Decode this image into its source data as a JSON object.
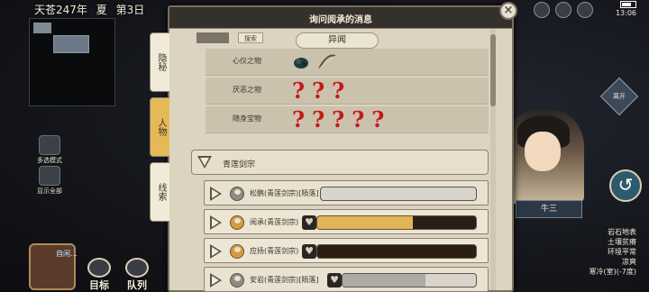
{
  "status_bar": {
    "date": "天苍247年",
    "season": "夏",
    "day": "第3日",
    "clock": "13:06"
  },
  "left_panel": {
    "buttons": [
      {
        "label": "多选模式"
      },
      {
        "label": "显示全部"
      }
    ],
    "npc_label": "自闲…",
    "bottom_buttons": [
      {
        "label": "目标"
      },
      {
        "label": "队列"
      }
    ]
  },
  "dialog": {
    "title": "询问阅承的消息",
    "close": "×",
    "tabs": [
      {
        "label": "隐秘",
        "active": false
      },
      {
        "label": "人物",
        "active": true
      },
      {
        "label": "线索",
        "active": false
      }
    ],
    "search_tag": "搜索",
    "section_title": "异闻",
    "properties": [
      {
        "label": "心仪之物",
        "items": [
          "ink-stone-icon",
          "bow-icon"
        ],
        "unknown": 0
      },
      {
        "label": "厌恶之物",
        "items": [],
        "unknown": 3,
        "unknown_glyph": "?"
      },
      {
        "label": "随身宝物",
        "items": [],
        "unknown": 5,
        "unknown_glyph": "?"
      }
    ],
    "sect_group": {
      "label": "青莲剑宗"
    },
    "members": [
      {
        "name": "松鹏(青莲剑宗)[陨落]",
        "deceased": true,
        "highlight": false,
        "favor": 0.0,
        "show_heart": false
      },
      {
        "name": "阅承(青莲剑宗)",
        "deceased": false,
        "highlight": true,
        "favor": 0.6,
        "show_heart": true
      },
      {
        "name": "应扬(青莲剑宗)",
        "deceased": false,
        "highlight": true,
        "favor": 0.0,
        "show_heart": true
      },
      {
        "name": "安岩(青莲剑宗)[陨落]",
        "deceased": true,
        "highlight": false,
        "favor": 0.62,
        "show_heart": true
      }
    ]
  },
  "right_panel": {
    "name_tag": "牛三",
    "diamond_label": "离开",
    "terrain": [
      "岩石地表",
      "土壤贫瘠",
      "环境平常",
      "凉爽",
      "寒冷(室)(-7度)"
    ]
  },
  "colors": {
    "accent_gold": "#e3b454",
    "question_red": "#c31a16",
    "dialog_bg": "#dcd4c1"
  }
}
